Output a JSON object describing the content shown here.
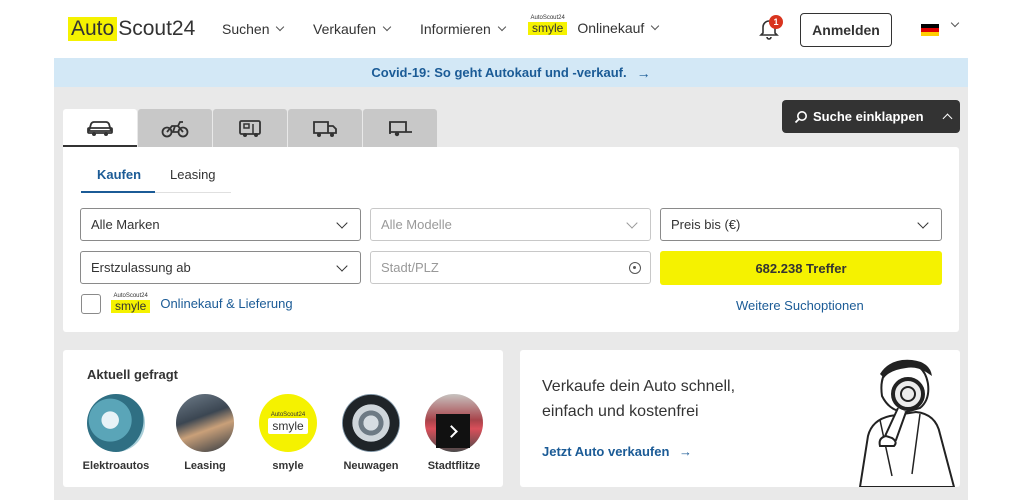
{
  "header": {
    "logo_auto": "Auto",
    "logo_scout": "Scout24",
    "nav": [
      {
        "label": "Suchen"
      },
      {
        "label": "Verkaufen"
      },
      {
        "label": "Informieren"
      }
    ],
    "smyle_brand_small": "AutoScout24",
    "smyle_brand": "smyle",
    "onlinekauf": "Onlinekauf",
    "notification_count": "1",
    "login_label": "Anmelden",
    "language": "de"
  },
  "banner": {
    "text": "Covid-19: So geht Autokauf und -verkauf.",
    "arrow": "→"
  },
  "vehicle_tabs": [
    {
      "icon": "car-icon",
      "active": true
    },
    {
      "icon": "motorbike-icon",
      "active": false
    },
    {
      "icon": "camper-icon",
      "active": false
    },
    {
      "icon": "truck-icon",
      "active": false
    },
    {
      "icon": "trailer-icon",
      "active": false
    }
  ],
  "collapse_label": "Suche einklappen",
  "search": {
    "tabs": [
      {
        "label": "Kaufen",
        "active": true
      },
      {
        "label": "Leasing",
        "active": false
      }
    ],
    "make_value": "Alle Marken",
    "model_value": "Alle Modelle",
    "price_value": "Preis bis (€)",
    "registration_value": "Erstzulassung ab",
    "location_placeholder": "Stadt/PLZ",
    "results_label": "682.238 Treffer",
    "online_brand_small": "AutoScout24",
    "online_brand": "smyle",
    "online_label": "Onlinekauf & Lieferung",
    "more_options_label": "Weitere Suchoptionen"
  },
  "trending": {
    "title": "Aktuell gefragt",
    "items": [
      {
        "label": "Elektroautos"
      },
      {
        "label": "Leasing"
      },
      {
        "label": "smyle",
        "brand_small": "AutoScout24",
        "brand": "smyle"
      },
      {
        "label": "Neuwagen"
      },
      {
        "label": "Stadtflitze"
      }
    ]
  },
  "sell": {
    "title": "Verkaufe dein Auto schnell, einfach und kostenfrei",
    "link_label": "Jetzt Auto verkaufen",
    "arrow": "→"
  },
  "colors": {
    "brand_yellow": "#f5f200",
    "link_blue": "#1b5b96",
    "dark": "#333333",
    "banner_bg": "#d3e8f6"
  }
}
